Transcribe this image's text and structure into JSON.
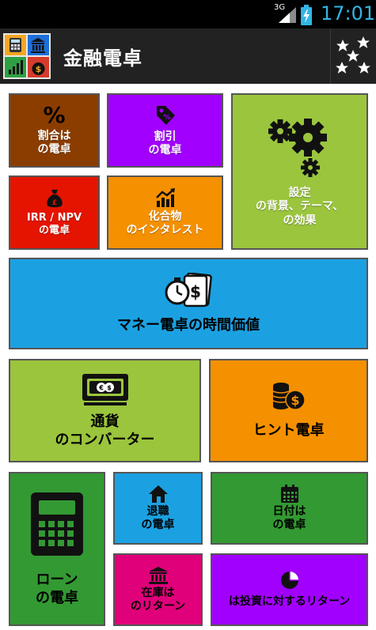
{
  "status_bar": {
    "network": "3G",
    "time": "17:01"
  },
  "app": {
    "title": "金融電卓",
    "logo_icon": "app-logo-icon",
    "rate_icon": "stars-icon"
  },
  "tiles": {
    "percentage": {
      "symbol": "%",
      "label": "割合は\nの電卓",
      "color": "#8b3d00"
    },
    "discount": {
      "label": "割引\nの電卓",
      "color": "#a100ff",
      "icon": "price-tag-icon"
    },
    "settings": {
      "label": "設定\nの背景、テーマ、\nの効果",
      "color": "#9bc53d",
      "icon": "gears-icon"
    },
    "irr_npv": {
      "label": "IRR / NPV\nの電卓",
      "color": "#e51400",
      "icon": "money-bag-icon"
    },
    "compound_interest": {
      "label": "化合物\nのインタレスト",
      "color": "#f59000",
      "icon": "growth-chart-icon"
    },
    "time_value": {
      "label": "マネー電卓の時間価値",
      "color": "#1ba1e2",
      "icon": "stopwatch-money-icon"
    },
    "currency": {
      "label": "通貨\nのコンバーター",
      "color": "#9bc53d",
      "icon": "banknote-icon"
    },
    "tip": {
      "label": "ヒント電卓",
      "color": "#f59000",
      "icon": "coins-icon"
    },
    "loan": {
      "label": "ローン\nの電卓",
      "color": "#339933",
      "icon": "calculator-icon"
    },
    "retirement": {
      "label": "退職\nの電卓",
      "color": "#1ba1e2",
      "icon": "house-icon"
    },
    "date": {
      "label": "日付は\nの電卓",
      "color": "#339933",
      "icon": "calendar-icon"
    },
    "inventory": {
      "label": "在庫は\nのリターン",
      "color": "#e0007a",
      "icon": "bank-icon"
    },
    "roi": {
      "label": "は投資に対するリターン",
      "color": "#a100ff",
      "icon": "pie-chart-icon"
    }
  }
}
